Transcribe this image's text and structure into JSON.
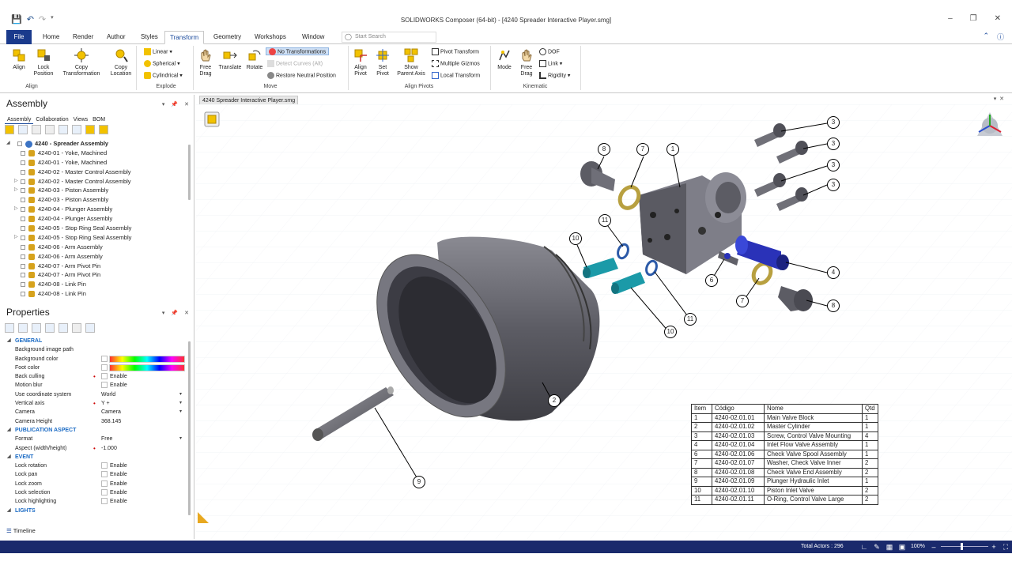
{
  "window": {
    "title": "SOLIDWORKS Composer (64-bit) - [4240 Spreader Interactive Player.smg]",
    "search_placeholder": "Start Search"
  },
  "ribbon_tabs": [
    "File",
    "Home",
    "Render",
    "Author",
    "Styles",
    "Transform",
    "Geometry",
    "Workshops",
    "Window"
  ],
  "active_tab": "Transform",
  "ribbon": {
    "align": {
      "label": "Align",
      "lock": "Lock Position",
      "group": "Align"
    },
    "explode": {
      "copy_transformation": "Copy Transformation",
      "copy_location": "Copy Location",
      "linear": "Linear",
      "spherical": "Spherical",
      "cylindrical": "Cylindrical",
      "group": "Explode"
    },
    "move": {
      "free_drag": "Free Drag",
      "translate": "Translate",
      "rotate": "Rotate",
      "no_transformations": "No Transformations",
      "detect_curves": "Detect Curves (Alt)",
      "restore_neutral": "Restore Neutral Position",
      "group": "Move"
    },
    "align_pivots": {
      "align_pivot": "Align Pivot",
      "set_pivot": "Set Pivot",
      "show_parent_axis": "Show Parent Axis",
      "pivot_transform": "Pivot Transform",
      "multiple_gizmos": "Multiple Gizmos",
      "local_transform": "Local Transform",
      "group": "Align Pivots"
    },
    "kinematic": {
      "mode": "Mode",
      "free_drag": "Free Drag",
      "dof": "DOF",
      "link": "Link",
      "rigidity": "Rigidity",
      "group": "Kinematic"
    }
  },
  "assembly_panel": {
    "title": "Assembly",
    "tabs": [
      "Assembly",
      "Collaboration",
      "Views",
      "BOM"
    ],
    "root": "4240 - Spreader Assembly",
    "items": [
      {
        "label": "4240-01 - Yoke, Machined",
        "expand": ""
      },
      {
        "label": "4240-01 - Yoke, Machined",
        "expand": ""
      },
      {
        "label": "4240-02 - Master Control Assembly",
        "expand": ""
      },
      {
        "label": "4240-02 - Master Control Assembly",
        "expand": "▷"
      },
      {
        "label": "4240-03 - Piston Assembly",
        "expand": "▷"
      },
      {
        "label": "4240-03 - Piston Assembly",
        "expand": ""
      },
      {
        "label": "4240-04 - Plunger Assembly",
        "expand": "▷"
      },
      {
        "label": "4240-04 - Plunger Assembly",
        "expand": ""
      },
      {
        "label": "4240-05 - Stop Ring Seal Assembly",
        "expand": ""
      },
      {
        "label": "4240-05 - Stop Ring Seal Assembly",
        "expand": "▷"
      },
      {
        "label": "4240-06 - Arm Assembly",
        "expand": ""
      },
      {
        "label": "4240-06 - Arm Assembly",
        "expand": ""
      },
      {
        "label": "4240-07 - Arm Pivot Pin",
        "expand": ""
      },
      {
        "label": "4240-07 - Arm Pivot Pin",
        "expand": ""
      },
      {
        "label": "4240-08 - Link Pin",
        "expand": ""
      },
      {
        "label": "4240-08 - Link Pin",
        "expand": ""
      }
    ]
  },
  "properties_panel": {
    "title": "Properties",
    "sections": {
      "general": "GENERAL",
      "publication": "PUBLICATION ASPECT",
      "event": "EVENT",
      "lights": "LIGHTS"
    },
    "general": [
      {
        "k": "Background image path",
        "v": ""
      },
      {
        "k": "Background color",
        "v": ""
      },
      {
        "k": "Foot color",
        "v": ""
      },
      {
        "k": "Back culling",
        "v": "Enable"
      },
      {
        "k": "Motion blur",
        "v": "Enable"
      },
      {
        "k": "Use coordinate system",
        "v": "World"
      },
      {
        "k": "Vertical axis",
        "v": "Y +"
      },
      {
        "k": "Camera",
        "v": "Camera"
      },
      {
        "k": "Camera Height",
        "v": "368.145"
      }
    ],
    "publication": [
      {
        "k": "Format",
        "v": "Free"
      },
      {
        "k": "Aspect (width/height)",
        "v": "-1.000"
      }
    ],
    "event": [
      {
        "k": "Lock rotation",
        "v": "Enable"
      },
      {
        "k": "Lock pan",
        "v": "Enable"
      },
      {
        "k": "Lock zoom",
        "v": "Enable"
      },
      {
        "k": "Lock selection",
        "v": "Enable"
      },
      {
        "k": "Lock highlighting",
        "v": "Enable"
      }
    ],
    "timeline": "Timeline"
  },
  "viewport": {
    "tab_label": "4240 Spreader Interactive Player.smg",
    "bom_headers": [
      "Item",
      "Código",
      "Nome",
      "Qtd"
    ],
    "bom_rows": [
      [
        "1",
        "4240-02.01.01",
        "Main Valve Block",
        "1"
      ],
      [
        "2",
        "4240-02.01.02",
        "Master Cylinder",
        "1"
      ],
      [
        "3",
        "4240-02.01.03",
        "Screw, Control Valve Mounting",
        "4"
      ],
      [
        "4",
        "4240-02.01.04",
        "Inlet Flow Valve Assembly",
        "1"
      ],
      [
        "6",
        "4240-02.01.06",
        "Check Valve Spool Assembly",
        "1"
      ],
      [
        "7",
        "4240-02.01.07",
        "Washer, Check Valve Inner",
        "2"
      ],
      [
        "8",
        "4240-02.01.08",
        "Check Valve End Assembly",
        "2"
      ],
      [
        "9",
        "4240-02.01.09",
        "Plunger Hydraulic Inlet",
        "1"
      ],
      [
        "10",
        "4240-02.01.10",
        "Piston Inlet Valve",
        "2"
      ],
      [
        "11",
        "4240-02.01.11",
        "O-Ring, Control Valve Large",
        "2"
      ]
    ],
    "callouts": [
      "1",
      "2",
      "3",
      "3",
      "3",
      "3",
      "4",
      "6",
      "7",
      "7",
      "8",
      "8",
      "9",
      "10",
      "10",
      "11",
      "11"
    ]
  },
  "status": {
    "total_actors": "Total Actors : 296",
    "zoom": "100%"
  },
  "colors": {
    "file_tab": "#1a3a8c",
    "status_bar": "#1a2a6c",
    "accent": "#1a4a9c"
  }
}
